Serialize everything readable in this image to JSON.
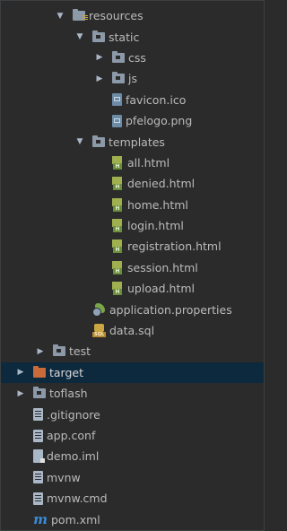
{
  "tree": [
    {
      "label": "resources",
      "arrow": "expanded",
      "icon": "resources-folder-icon",
      "indent": 60
    },
    {
      "label": "static",
      "arrow": "expanded",
      "icon": "folder-icon",
      "indent": 82
    },
    {
      "label": "css",
      "arrow": "collapsed",
      "icon": "folder-icon",
      "indent": 104
    },
    {
      "label": "js",
      "arrow": "collapsed",
      "icon": "folder-icon",
      "indent": 104
    },
    {
      "label": "favicon.ico",
      "arrow": "none",
      "icon": "image-file-icon",
      "indent": 104
    },
    {
      "label": "pfelogo.png",
      "arrow": "none",
      "icon": "image-file-icon",
      "indent": 104
    },
    {
      "label": "templates",
      "arrow": "expanded",
      "icon": "folder-icon",
      "indent": 82
    },
    {
      "label": "all.html",
      "arrow": "none",
      "icon": "html-file-icon",
      "indent": 104
    },
    {
      "label": "denied.html",
      "arrow": "none",
      "icon": "html-file-icon",
      "indent": 104
    },
    {
      "label": "home.html",
      "arrow": "none",
      "icon": "html-file-icon",
      "indent": 104
    },
    {
      "label": "login.html",
      "arrow": "none",
      "icon": "html-file-icon",
      "indent": 104
    },
    {
      "label": "registration.html",
      "arrow": "none",
      "icon": "html-file-icon",
      "indent": 104
    },
    {
      "label": "session.html",
      "arrow": "none",
      "icon": "html-file-icon",
      "indent": 104
    },
    {
      "label": "upload.html",
      "arrow": "none",
      "icon": "html-file-icon",
      "indent": 104
    },
    {
      "label": "application.properties",
      "arrow": "none",
      "icon": "properties-file-icon",
      "indent": 82
    },
    {
      "label": "data.sql",
      "arrow": "none",
      "icon": "sql-file-icon",
      "indent": 82
    },
    {
      "label": "test",
      "arrow": "collapsed",
      "icon": "folder-icon",
      "indent": 38
    },
    {
      "label": "target",
      "arrow": "collapsed",
      "icon": "target-folder-icon",
      "indent": 16,
      "selected": true
    },
    {
      "label": "toflash",
      "arrow": "collapsed",
      "icon": "folder-icon",
      "indent": 16
    },
    {
      "label": ".gitignore",
      "arrow": "none",
      "icon": "text-file-icon",
      "indent": 16
    },
    {
      "label": "app.conf",
      "arrow": "none",
      "icon": "text-file-icon",
      "indent": 16
    },
    {
      "label": "demo.iml",
      "arrow": "none",
      "icon": "iml-file-icon",
      "indent": 16
    },
    {
      "label": "mvnw",
      "arrow": "none",
      "icon": "text-file-icon",
      "indent": 16
    },
    {
      "label": "mvnw.cmd",
      "arrow": "none",
      "icon": "text-file-icon",
      "indent": 16
    },
    {
      "label": "pom.xml",
      "arrow": "none",
      "icon": "maven-icon",
      "indent": 16
    }
  ],
  "colors": {
    "background": "#2b2b2b",
    "selection": "#0d293e",
    "text": "#bbbbbb",
    "folder": "#8c99a8",
    "target_folder": "#c86a3a",
    "html_icon": "#a0b04e"
  },
  "arrow_glyphs": {
    "expanded": "▼",
    "collapsed": "▶"
  }
}
